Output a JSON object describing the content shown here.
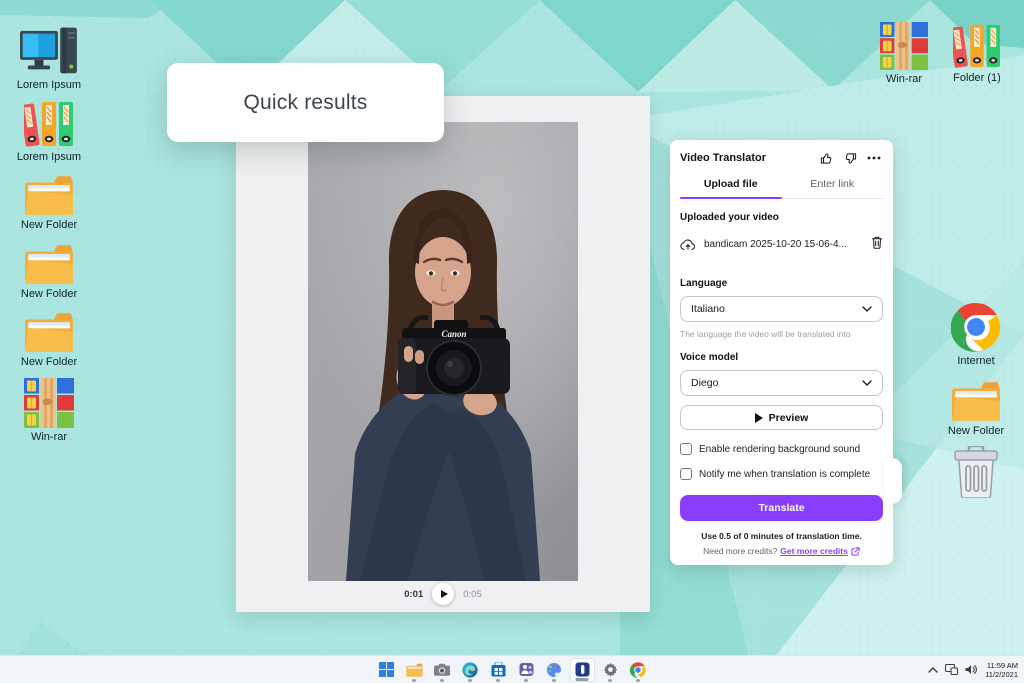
{
  "desktop": {
    "left_icons": [
      {
        "label": "Lorem Ipsum",
        "icon": "computer-icon"
      },
      {
        "label": "Lorem Ipsum",
        "icon": "binders-icon"
      },
      {
        "label": "New Folder",
        "icon": "folder-icon"
      },
      {
        "label": "New Folder",
        "icon": "folder-icon"
      },
      {
        "label": "New Folder",
        "icon": "folder-icon"
      },
      {
        "label": "Win-rar",
        "icon": "winrar-icon"
      }
    ],
    "top_right_icons": [
      {
        "label": "Win-rar",
        "icon": "winrar-icon"
      },
      {
        "label": "Folder (1)",
        "icon": "binders-icon"
      }
    ],
    "right_icons": [
      {
        "label": "Internet",
        "icon": "chrome-icon"
      },
      {
        "label": "New Folder",
        "icon": "folder-icon"
      },
      {
        "label": "",
        "icon": "recycle-bin-icon"
      }
    ]
  },
  "quick_results": {
    "text": "Quick results"
  },
  "player": {
    "current_time": "0:01",
    "total_time": "0:05"
  },
  "photo": {
    "camera_brand": "Canon"
  },
  "panel": {
    "title": "Video Translator",
    "tabs": [
      {
        "label": "Upload file"
      },
      {
        "label": "Enter link"
      }
    ],
    "uploaded_label": "Uploaded your video",
    "file_name": "bandicam 2025-10-20 15-06-4...",
    "language_label": "Language",
    "language_value": "Italiano",
    "language_help": "The language the video will be translated into",
    "voice_label": "Voice model",
    "voice_value": "Diego",
    "preview_label": "Preview",
    "checkboxes": [
      {
        "label": "Enable rendering background sound",
        "checked": false
      },
      {
        "label": "Notify me when translation is complete",
        "checked": false
      }
    ],
    "translate_label": "Translate",
    "credits_line": "Use 0.5 of 0 minutes of translation time.",
    "need_credits_text": "Need more credits?",
    "credits_link_label": "Get more credits"
  },
  "taskbar": {
    "time": "11:59 AM",
    "date": "11/2/2021"
  },
  "colors": {
    "accent_purple": "#8b3dff",
    "desktop_teal": "#abe5df",
    "panel_bg": "#f0f0f2",
    "taskbar_bg": "#f1f5fa"
  }
}
